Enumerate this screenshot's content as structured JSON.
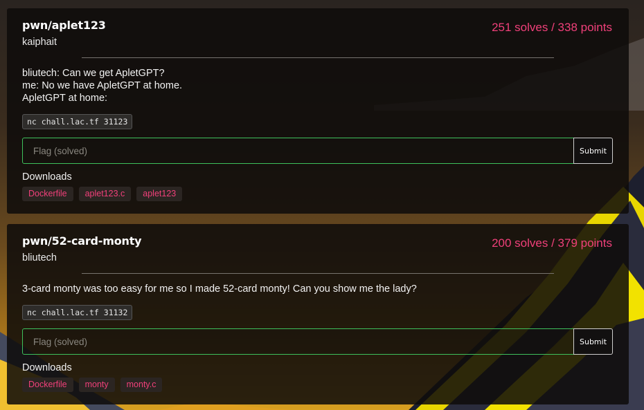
{
  "challenges": [
    {
      "title": "pwn/aplet123",
      "author": "kaiphait",
      "score": "251 solves / 338 points",
      "description": [
        "bliutech: Can we get ApletGPT?",
        "me: No we have ApletGPT at home.",
        "ApletGPT at home:"
      ],
      "command": "nc chall.lac.tf 31123",
      "flag_placeholder": "Flag (solved)",
      "submit_label": "Submit",
      "downloads_label": "Downloads",
      "downloads": [
        "Dockerfile",
        "aplet123.c",
        "aplet123"
      ]
    },
    {
      "title": "pwn/52-card-monty",
      "author": "bliutech",
      "score": "200 solves / 379 points",
      "description": [
        "3-card monty was too easy for me so I made 52-card monty! Can you show me the lady?"
      ],
      "command": "nc chall.lac.tf 31132",
      "flag_placeholder": "Flag (solved)",
      "submit_label": "Submit",
      "downloads_label": "Downloads",
      "downloads": [
        "Dockerfile",
        "monty",
        "monty.c"
      ]
    }
  ],
  "colors": {
    "accent": "#f0407a",
    "flag_border": "#3ec15c",
    "card_bg": "#0e0c0a"
  }
}
